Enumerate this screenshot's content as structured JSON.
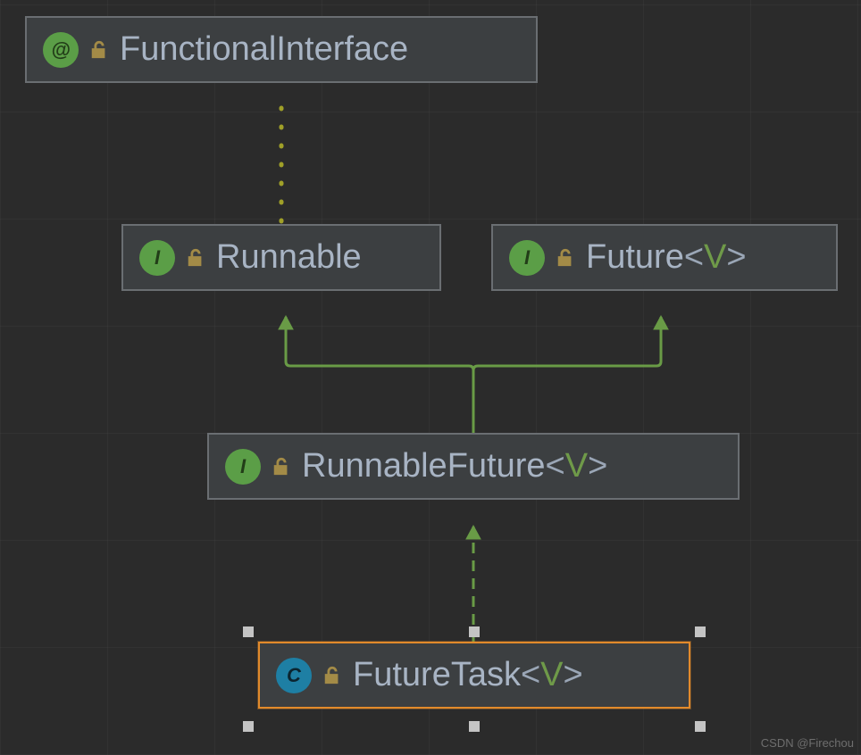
{
  "diagram": {
    "nodes": {
      "functionalInterface": {
        "name": "FunctionalInterface",
        "kind": "@"
      },
      "runnable": {
        "name": "Runnable",
        "kind": "I"
      },
      "future": {
        "name": "Future",
        "generic": "V",
        "kind": "I"
      },
      "runnableFuture": {
        "name": "RunnableFuture",
        "generic": "V",
        "kind": "I"
      },
      "futureTask": {
        "name": "FutureTask",
        "generic": "V",
        "kind": "C"
      }
    }
  },
  "colors": {
    "interface_badge": "#5b9e47",
    "class_badge": "#1e7fa4",
    "node_bg": "#3c3f41",
    "border": "#6a6e72",
    "selected": "#e28a2b",
    "generic": "#6f9a49",
    "text": "#a8b4c4",
    "arrow": "#699b46"
  },
  "watermark": "CSDN @Firechou"
}
